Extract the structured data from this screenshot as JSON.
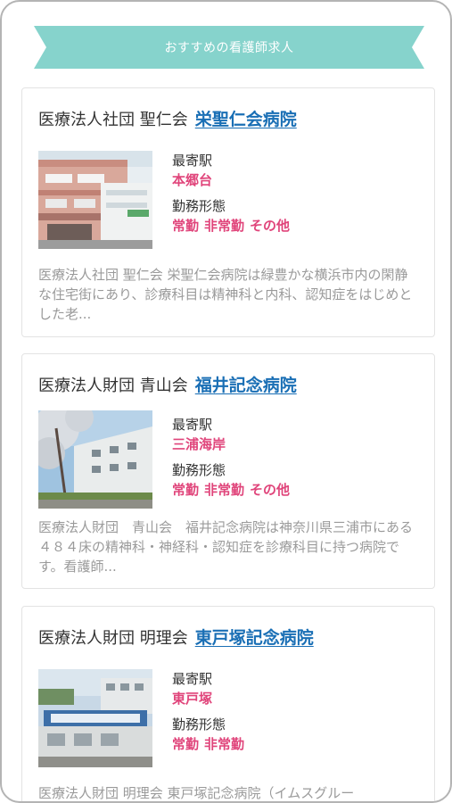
{
  "banner": {
    "title": "おすすめの看護師求人"
  },
  "labels": {
    "station": "最寄駅",
    "work_style": "勤務形態"
  },
  "colors": {
    "ribbon": "#86d3cc",
    "ribbon_fold": "#6fc1ba",
    "link": "#1a6fb5",
    "accent": "#e0457b"
  },
  "cards": [
    {
      "org": "医療法人社団 聖仁会",
      "hospital": "栄聖仁会病院",
      "image": "hospital-building-photo",
      "station": "本郷台",
      "work": [
        "常勤",
        "非常勤",
        "その他"
      ],
      "description": "医療法人社団 聖仁会 栄聖仁会病院は緑豊かな横浜市内の閑静な住宅街にあり、診療科目は精神科と内科、認知症をはじめとした老..."
    },
    {
      "org": "医療法人財団 青山会",
      "hospital": "福井記念病院",
      "image": "hospital-cherry-blossom-photo",
      "station": "三浦海岸",
      "work": [
        "常勤",
        "非常勤",
        "その他"
      ],
      "description": "医療法人財団　青山会　福井記念病院は神奈川県三浦市にある４８４床の精神科・神経科・認知症を診療科目に持つ病院です。看護師..."
    },
    {
      "org": "医療法人財団 明理会",
      "hospital": "東戸塚記念病院",
      "image": "hospital-sign-photo",
      "station": "東戸塚",
      "work": [
        "常勤",
        "非常勤"
      ],
      "description": "医療法人財団 明理会 東戸塚記念病院（イムスグルー"
    }
  ]
}
